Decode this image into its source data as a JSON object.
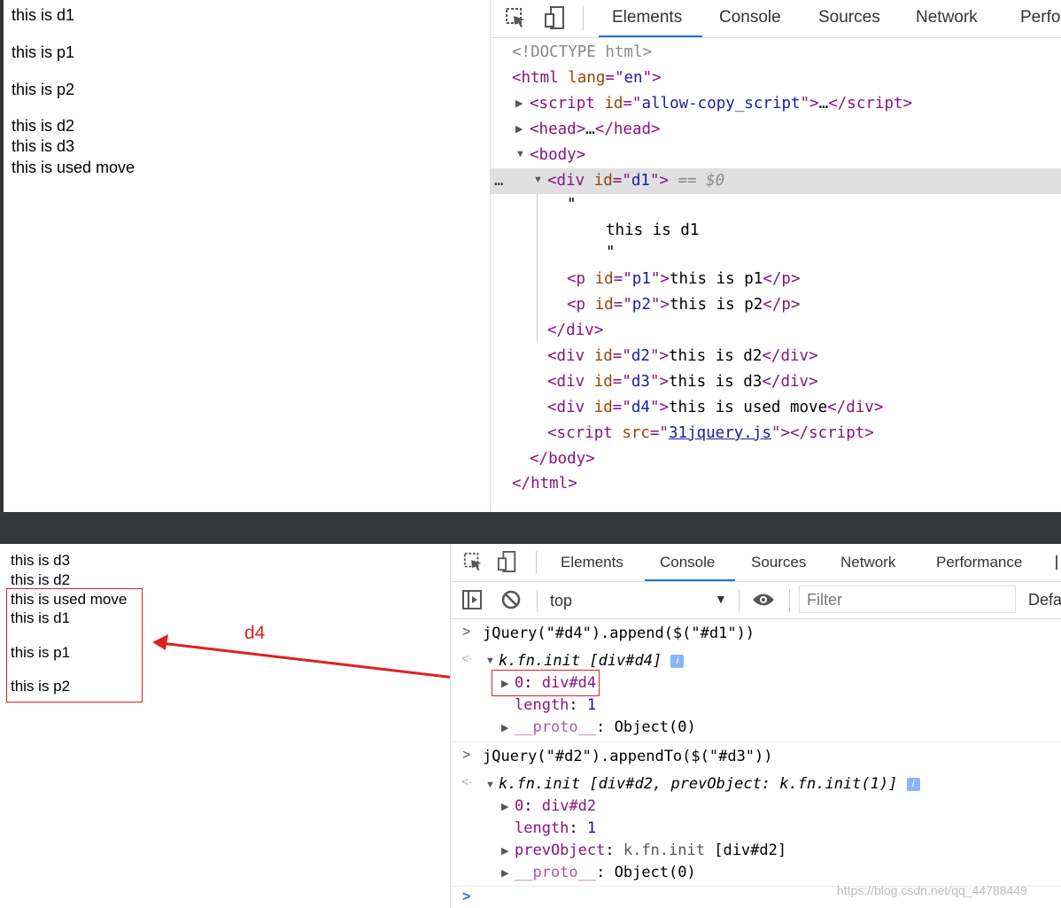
{
  "top": {
    "page": {
      "lines": [
        "this is d1",
        "this is p1",
        "this is p2",
        "this is d2",
        "this is d3",
        "this is used move"
      ]
    },
    "devtools": {
      "tabs": [
        "Elements",
        "Console",
        "Sources",
        "Network",
        "Perfo"
      ],
      "active_tab": "Elements",
      "dom": {
        "doctype": "<!DOCTYPE html>",
        "html_open_tag": "html",
        "html_lang_attr": "lang",
        "html_lang_val": "en",
        "script_tag": "script",
        "script_id_attr": "id",
        "script_id_val": "allow-copy_script",
        "ellipsis": "…",
        "head_tag": "head",
        "body_tag": "body",
        "div_tag": "div",
        "id_attr": "id",
        "d1_id": "d1",
        "selected_marker": "== $0",
        "dots": "…",
        "quote": "\"",
        "d1_text": "this is d1",
        "p_tag": "p",
        "p1_id": "p1",
        "p1_text": "this is p1",
        "p2_id": "p2",
        "p2_text": "this is p2",
        "d2_id": "d2",
        "d2_text": "this is d2",
        "d3_id": "d3",
        "d3_text": "this is d3",
        "d4_id": "d4",
        "d4_text": "this is used move",
        "src_attr": "src",
        "src_val": "31jquery.js"
      }
    }
  },
  "bottom": {
    "page": {
      "lines_plain": [
        "this is d3",
        "this is d2"
      ],
      "boxed_lines": [
        "this is used move",
        "this is d1",
        "this is p1",
        "this is p2"
      ]
    },
    "annotation": {
      "label": "d4",
      "color": "#e02020"
    },
    "devtools": {
      "tabs": [
        "Elements",
        "Console",
        "Sources",
        "Network",
        "Performance"
      ],
      "active_tab": "Console",
      "context": "top",
      "filter_placeholder": "Filter",
      "levels": "Defa",
      "console": {
        "cmd1": "jQuery(\"#d4\").append($(\"#d1\"))",
        "res1_head": "k.fn.init [div#d4]",
        "res1_item0_key": "0",
        "res1_item0_val": "div#d4",
        "length_key": "length",
        "length_val": "1",
        "proto_key": "__proto__",
        "proto_val": "Object(0)",
        "cmd2": "jQuery(\"#d2\").appendTo($(\"#d3\"))",
        "res2_head": "k.fn.init [div#d2, prevObject: k.fn.init(1)]",
        "res2_item0_key": "0",
        "res2_item0_val": "div#d2",
        "prev_key": "prevObject",
        "prev_val_a": "k.fn.init",
        "prev_val_b": "[div#d2]",
        "info_badge": "i"
      }
    }
  },
  "watermark": "https://blog.csdn.net/qq_44788449",
  "colors": {
    "accent": "#1a73e8",
    "separator": "#35363a",
    "highlight": "#e0e0e0",
    "annotation": "#e02020"
  }
}
